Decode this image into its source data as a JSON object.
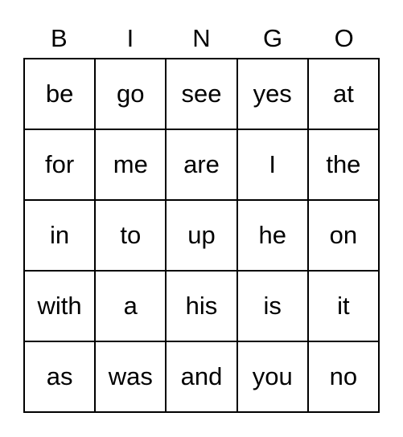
{
  "header": [
    "B",
    "I",
    "N",
    "G",
    "O"
  ],
  "rows": [
    [
      "be",
      "go",
      "see",
      "yes",
      "at"
    ],
    [
      "for",
      "me",
      "are",
      "I",
      "the"
    ],
    [
      "in",
      "to",
      "up",
      "he",
      "on"
    ],
    [
      "with",
      "a",
      "his",
      "is",
      "it"
    ],
    [
      "as",
      "was",
      "and",
      "you",
      "no"
    ]
  ]
}
